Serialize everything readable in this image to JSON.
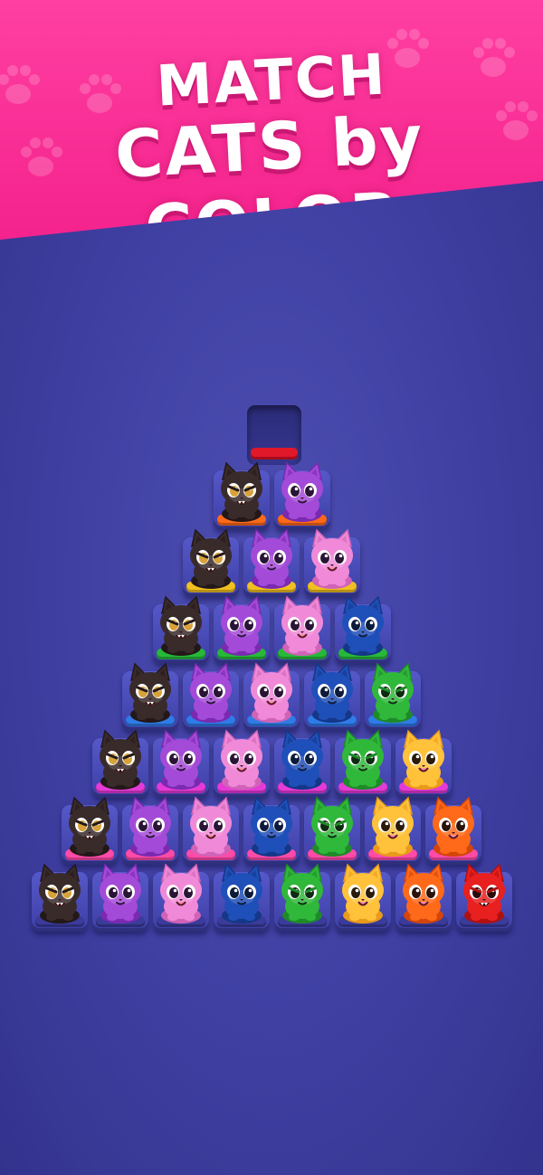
{
  "banner": {
    "line1": "MATCH",
    "line2": "CATS by COLOR"
  },
  "colors": {
    "black": {
      "body": "#3a2b2b",
      "shade": "#231818",
      "eye": "#d8a23a",
      "base": "#e0182a"
    },
    "purple": {
      "body": "#a44ad8",
      "shade": "#7a2ab0",
      "eye": "#2a1436",
      "base": "#ff6a1a"
    },
    "pink": {
      "body": "#f08ad8",
      "shade": "#d063b8",
      "eye": "#2a1436",
      "base": "#f0c020"
    },
    "blue": {
      "body": "#1f4fb8",
      "shade": "#143788",
      "eye": "#0c1a3a",
      "base": "#27b83a"
    },
    "green": {
      "body": "#30b83a",
      "shade": "#1e8a28",
      "eye": "#0e2a10",
      "base": "#2f7be8"
    },
    "yellow": {
      "body": "#ffc23a",
      "shade": "#e89a1a",
      "eye": "#2a1a0a",
      "base": "#e63ad6"
    },
    "orange": {
      "body": "#ff6a1a",
      "shade": "#d4450a",
      "eye": "#2a120a",
      "base": "#ff4aa8"
    },
    "red": {
      "body": "#e8201f",
      "shade": "#b01010",
      "eye": "#2a0a0a",
      "base": "#3a3b9a"
    }
  },
  "rows": [
    {
      "base": "#ff6a1a",
      "cats": [
        "black",
        "purple"
      ]
    },
    {
      "base": "#f0c020",
      "cats": [
        "black",
        "purple",
        "pink"
      ]
    },
    {
      "base": "#27b83a",
      "cats": [
        "black",
        "purple",
        "pink",
        "blue"
      ]
    },
    {
      "base": "#2f7be8",
      "cats": [
        "black",
        "purple",
        "pink",
        "blue",
        "green"
      ]
    },
    {
      "base": "#e63ad6",
      "cats": [
        "black",
        "purple",
        "pink",
        "blue",
        "green",
        "yellow"
      ]
    },
    {
      "base": "#ff4aa8",
      "cats": [
        "black",
        "purple",
        "pink",
        "blue",
        "green",
        "yellow",
        "orange"
      ]
    },
    {
      "base": "#3a3b9a",
      "cats": [
        "black",
        "purple",
        "pink",
        "blue",
        "green",
        "yellow",
        "orange",
        "red"
      ]
    }
  ]
}
